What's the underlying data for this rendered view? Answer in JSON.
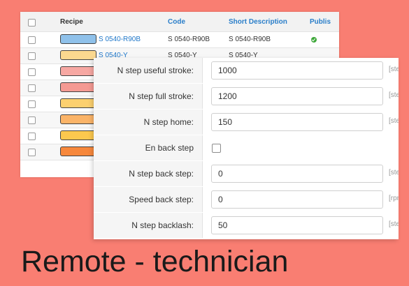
{
  "recipe_table": {
    "headers": {
      "recipe": "Recipe",
      "code": "Code",
      "short_description": "Short Description",
      "published": "Publis"
    },
    "rows": [
      {
        "color": "#8fc1ea",
        "recipe": "S 0540-R90B",
        "code": "S 0540-R90B",
        "short_description": "S 0540-R90B",
        "published": true
      },
      {
        "color": "#fbd88f",
        "recipe": "S 0540-Y",
        "code": "S 0540-Y",
        "short_description": "S 0540-Y",
        "published": null
      },
      {
        "color": "#f7a8a3",
        "recipe": "",
        "code": "",
        "short_description": "",
        "published": null
      },
      {
        "color": "#f59a93",
        "recipe": "",
        "code": "",
        "short_description": "",
        "published": null
      },
      {
        "color": "#fcd06f",
        "recipe": "",
        "code": "",
        "short_description": "",
        "published": null
      },
      {
        "color": "#fbb468",
        "recipe": "",
        "code": "",
        "short_description": "",
        "published": null
      },
      {
        "color": "#fcc84e",
        "recipe": "",
        "code": "",
        "short_description": "",
        "published": null
      },
      {
        "color": "#f7883c",
        "recipe": "",
        "code": "",
        "short_description": "",
        "published": null
      }
    ]
  },
  "settings_form": {
    "fields": [
      {
        "label": "N step useful stroke:",
        "value": "1000",
        "unit": "[step]"
      },
      {
        "label": "N step full stroke:",
        "value": "1200",
        "unit": "[step]"
      },
      {
        "label": "N step home:",
        "value": "150",
        "unit": "[step]"
      },
      {
        "label": "En back step",
        "checkbox": true,
        "checked": false
      },
      {
        "label": "N step back step:",
        "value": "0",
        "unit": "[step]"
      },
      {
        "label": "Speed back step:",
        "value": "0",
        "unit": "[rpm]"
      },
      {
        "label": "N step backlash:",
        "value": "50",
        "unit": "[step]"
      }
    ]
  },
  "caption": "Remote - technician",
  "colors": {
    "background": "#f97e72",
    "link": "#1f77c9",
    "published_ok": "#3ea83a"
  }
}
